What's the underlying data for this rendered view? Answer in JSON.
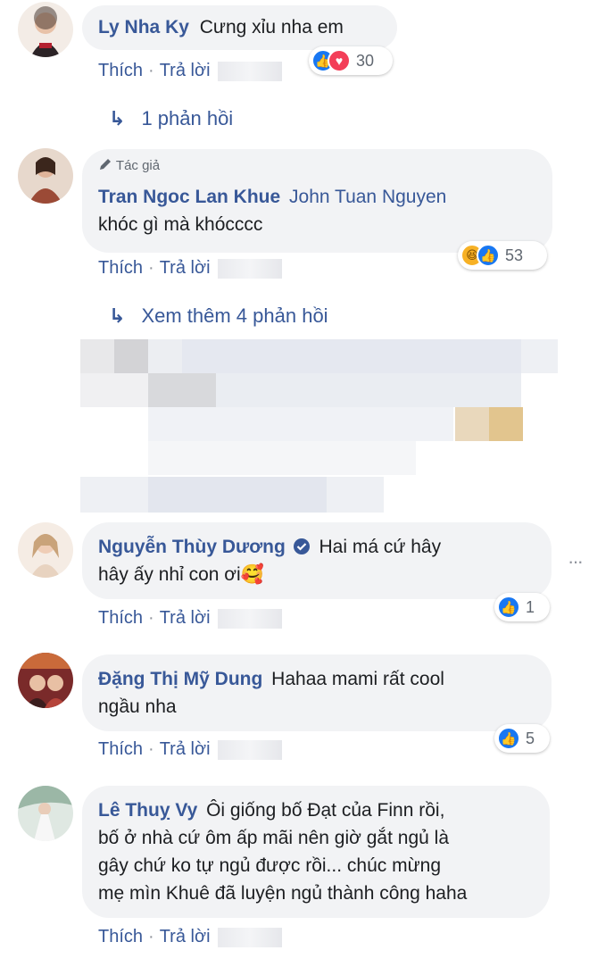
{
  "comments": [
    {
      "name": "Ly Nha Ky",
      "text": "Cưng xỉu nha em",
      "like": "Thích",
      "reply": "Trả lời",
      "reactions": "30"
    },
    {
      "badge": "Tác giả",
      "name": "Tran Ngoc Lan Khue",
      "mention": "John Tuan Nguyen",
      "text": "khóc gì mà khócccc",
      "like": "Thích",
      "reply": "Trả lời",
      "reactions": "53"
    },
    {
      "name": "Nguyễn Thùy Dương",
      "text_line1": "Hai má cứ hây",
      "text_line2": "hây ấy nhỉ con ơi",
      "emoji": "🥰",
      "like": "Thích",
      "reply": "Trả lời",
      "reactions": "1"
    },
    {
      "name": "Đặng Thị Mỹ Dung",
      "text_line1": "Hahaa mami rất cool",
      "text_line2": "ngầu nha",
      "like": "Thích",
      "reply": "Trả lời",
      "reactions": "5"
    },
    {
      "name": "Lê Thuỵ Vy",
      "text_line1": "Ôi giống bố Đạt của Finn rồi,",
      "text_line2": "bố ở nhà cứ ôm ấp mãi nên giờ gắt ngủ là",
      "text_line3": "gây chứ ko tự ngủ được rồi... chúc mừng",
      "text_line4": "mẹ mìn Khuê đã luyện ngủ thành công haha",
      "like": "Thích",
      "reply": "Trả lời"
    }
  ],
  "replies_link_1": "1 phản hồi",
  "replies_link_2": "Xem thêm 4 phản hồi",
  "more_menu": "···",
  "icons": {
    "reply_arrow": "↳",
    "verified": "verified-badge-icon",
    "pencil": "pencil-icon"
  },
  "colors": {
    "link": "#385898",
    "bubble": "#f2f3f5",
    "like": "#1877f2",
    "love": "#f33e58"
  }
}
